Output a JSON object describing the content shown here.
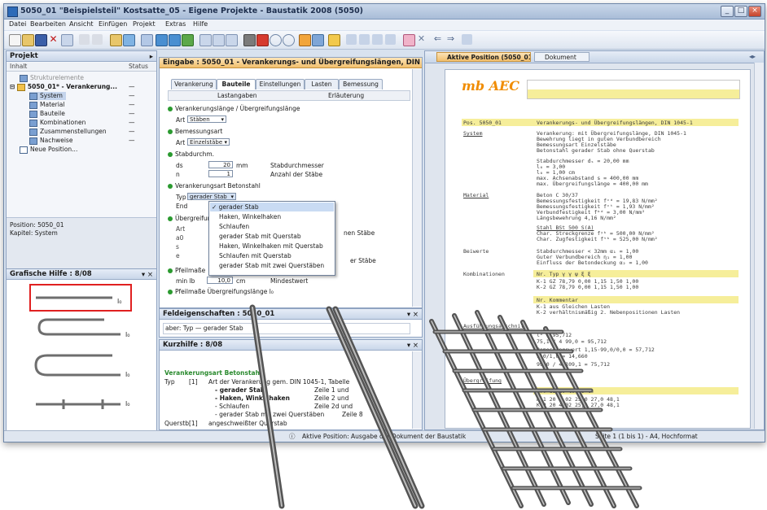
{
  "window": {
    "title": "5050_01 \"Beispielsteil\" Kostsatte_05 - Eigene Projekte - Baustatik 2008 (5050)",
    "minimize_label": "_",
    "maximize_label": "□",
    "close_label": "×"
  },
  "menu": [
    "Datei",
    "Bearbeiten",
    "Ansicht",
    "Einfügen",
    "Projekt",
    "Extras",
    "Hilfe"
  ],
  "project_panel": {
    "title": "Projekt",
    "col_name": "Inhalt",
    "col_status": "Status",
    "tree": [
      {
        "label": "Strukturelemente",
        "status": "—"
      },
      {
        "label": "5050_01* - Verankerung...",
        "status": "—"
      },
      {
        "label": "System",
        "status": "—"
      },
      {
        "label": "Material",
        "status": "—"
      },
      {
        "label": "Bauteile",
        "status": "—"
      },
      {
        "label": "Kombinationen",
        "status": "—"
      },
      {
        "label": "Zusammenstellungen",
        "status": "—"
      },
      {
        "label": "Nachweise",
        "status": "—"
      },
      {
        "label": "Neue Position...",
        "status": ""
      }
    ],
    "position_label": "Position: 5050_01",
    "kapitel_label": "Kapitel: System"
  },
  "graphic_panel": {
    "title": "Grafische Hilfe : 8/08",
    "labels": [
      "l₀",
      "l₀",
      "l₀",
      "l₀"
    ]
  },
  "input_panel": {
    "title": "Eingabe : 5050_01 - Verankerungs- und Übergreifungslängen, DIN ...",
    "tabs": [
      "Verankerung",
      "Bauteile",
      "Einstellungen",
      "Lasten",
      "Bemessung"
    ],
    "subtabs": [
      "Lastangaben",
      "Erläuterung"
    ],
    "sections": [
      "Verankerungslänge / Übergreifungslänge",
      "Bemessungsart",
      "Stabdurchm.",
      "Verankerungsart Betonstahl",
      "Übergreifungsstoß",
      "Pfeilmaße",
      "Pfeilmaße Übergreifungslänge l₀"
    ],
    "art_label": "Art",
    "art_value": "Stäben",
    "bem_label": "Art",
    "bem_value": "Einzelstäbe",
    "ds_label": "ds",
    "ds_value": "20",
    "ds_unit": "mm",
    "ds_desc": "Stabdurchmesser",
    "n_label": "n",
    "n_value": "1",
    "n_desc": "Anzahl der Stäbe",
    "typ_label": "Typ",
    "typ_value": "gerader Stab",
    "end_label": "End",
    "dropdown_options": [
      "✓ gerader Stab",
      "Haken, Winkelhaken",
      "Schlaufen",
      "gerader Stab mit Querstab",
      "Haken, Winkelhaken mit Querstab",
      "Schlaufen mit Querstab",
      "gerader Stab mit zwei Querstäben"
    ],
    "side_text_1": "nen Stäbe",
    "side_text_2": "er Stäbe",
    "mini_label": "min lb",
    "mini_value": "10,0",
    "mini_unit": "cm",
    "mini_desc": "Mindestwert"
  },
  "feld_panel": {
    "title": "Feldeigenschaften : 5050_01",
    "content": "aber: Typ — gerader Stab"
  },
  "info_panel": {
    "title": "Kurzhilfe : 8/08",
    "heading": "Verankerungsart Betonstahl",
    "typ_label": "Typ",
    "typ_num": "[1]",
    "lines": [
      {
        "left": "Art der Verankerung gem. DIN 1045-1, Tabelle",
        "right": ""
      },
      {
        "left": "- gerader Stab",
        "right": "Zeile 1 und"
      },
      {
        "left": "- Haken, Winkelhaken",
        "right": "Zeile 2 und"
      },
      {
        "left": "- Schlaufen",
        "right": "Zeile 2d und"
      },
      {
        "left": "- gerader Stab mit zwei Querstäben",
        "right": "Zeile 8"
      }
    ],
    "querstab_label": "Querstb",
    "querstab_num": "[1]",
    "querstab_text": "angeschweißter Querstab"
  },
  "doc_panel": {
    "tabs": [
      "Aktive Position (5050_01)",
      "Dokument"
    ],
    "logo": "mb AEC",
    "pos_title": "Pos. 5050_01",
    "pos_desc": "Verankerungs- und Übergreifungslängen, DIN 1045-1",
    "sections": [
      {
        "name": "System",
        "lines": [
          "Verankerung: mit Übergreifungslänge, DIN 1045-1",
          "Bewehrung liegt in guten Verbundbereich",
          "Bemessungsart Einzelstäbe",
          "Betonstahl gerader Stab ohne Querstab"
        ]
      },
      {
        "name": "",
        "lines": [
          "Stabdurchmesser       dₛ    =   20,00   mm",
          "                      l₀    =    3,00",
          "                      l₀    =    1,00    cm",
          "max. Achsenabstand    s     =  400,00   mm",
          "max. Übergreifungslänge      =  400,00   mm"
        ]
      },
      {
        "name": "Material",
        "lines": [
          "Beton     C 30/37",
          "Bemessungsfestigkeit  fᶜᵈ  =   19,83 N/mm²",
          "Bemessungsfestigkeit  fᶜᵗ  =    1,93 N/mm²",
          "Verbundfestigkeit     fᵇᵈ  =    3,00 N/mm²",
          "Längsbewehrung                     4,16 N/mm²"
        ]
      },
      {
        "name": "",
        "lines": [
          "Stahl       BSt 500 S(A)",
          "Char. Streckgrenze    fʸᵏ  =  500,00 N/mm²",
          "Char. Zugfestigkeit   fᵗᵏ  =  525,00 N/mm²"
        ]
      },
      {
        "name": "Beiwerte",
        "lines": [
          "Stabdurchmesser < 32mm  α₁  =   1,00",
          "Guter Verbundbereich  η₁    =   1,00",
          "Einfluss der Betondeckung α₂ =   1,00"
        ]
      },
      {
        "name": "Kombinationen",
        "lines": [
          "Nr.   Typ        γ      γ       ψ       ξ     ξ",
          "K-1   GZ     78,79   0,00    1,15  1,50  1,00",
          "K-2   GZ     78,79   0,00    1,15  1,50  1,00"
        ]
      },
      {
        "name": "",
        "lines": [
          "Nr.    Kommentar",
          "K-1    aus Gleichen Lasten",
          "K-2    verhältnismäßig 2. Nebenpositionen Lasten"
        ]
      },
      {
        "name": "Ausführungsabschnitt",
        "lines": [
          "                               lᵇ =   95,712",
          "                   75,1 / 4 99,0 =    95,712",
          "Bemessungswert      1,15·99,0/0,0 =    57,712",
          "                       1,0/1,0 =    14,660",
          "                    99,0 / 4 109,1 =    75,712"
        ]
      },
      {
        "name": "Übergreifung",
        "lines": [
          "Nr.    ds     l₀      l₀      α₁    l₀",
          "K-1    20    4,02    25,0    27,0   48,1",
          "K-2    20    4,02    25,0    27,0   48,1"
        ]
      }
    ]
  },
  "statusbar": {
    "center": "Aktive Position: Ausgabe der Dokument der Baustatik",
    "right": "Seite 1 (1 bis 1) - A4, Hochformat"
  },
  "colors": {
    "accent_orange": "#f2bf6d",
    "highlight_yellow": "#f6ee9a",
    "status_green": "#2a9a2f",
    "selection_red": "#e02020",
    "logo_orange": "#f08c00"
  }
}
